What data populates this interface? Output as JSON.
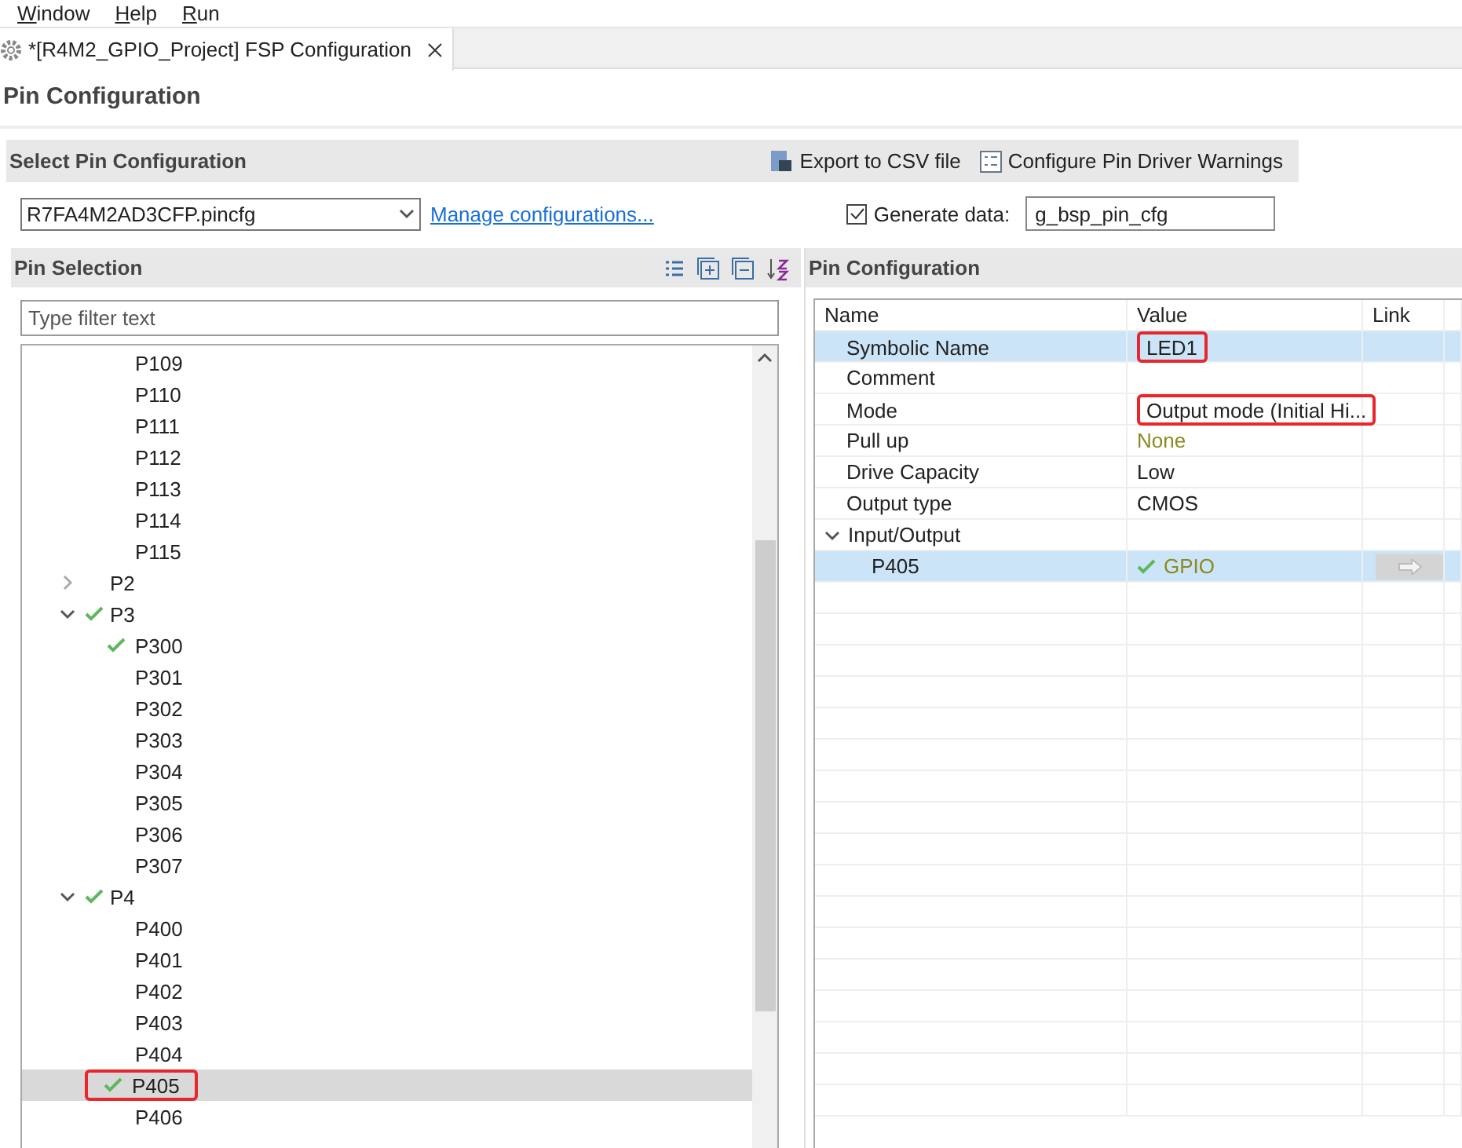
{
  "menu": [
    {
      "label": "Window"
    },
    {
      "label": "Help"
    },
    {
      "label": "Run"
    }
  ],
  "editor_tab": {
    "title": "*[R4M2_GPIO_Project] FSP Configuration",
    "selected": true
  },
  "page_title": "Pin Configuration",
  "select_section": {
    "title": "Select Pin Configuration",
    "actions": [
      {
        "kind": "export",
        "label": "Export to CSV file"
      },
      {
        "kind": "warnings",
        "label": "Configure Pin Driver Warnings"
      }
    ],
    "config_file": "R7FA4M2AD3CFP.pincfg",
    "manage_link": "Manage configurations...",
    "generate": {
      "label": "Generate data:",
      "checked": true,
      "value": "g_bsp_pin_cfg"
    }
  },
  "pin_selection": {
    "title": "Pin Selection",
    "filter_placeholder": "Type filter text",
    "tree": [
      {
        "children": [
          {
            "label": "P109",
            "checked": false,
            "selected": false
          },
          {
            "label": "P110",
            "checked": false,
            "selected": false
          },
          {
            "label": "P111",
            "checked": false,
            "selected": false
          },
          {
            "label": "P112",
            "checked": false,
            "selected": false
          },
          {
            "label": "P113",
            "checked": false,
            "selected": false
          },
          {
            "label": "P114",
            "checked": false,
            "selected": false
          },
          {
            "label": "P115",
            "checked": false,
            "selected": false
          }
        ]
      },
      {
        "label": "P2",
        "expanded": false,
        "checked": false
      },
      {
        "label": "P3",
        "expanded": true,
        "checked": true,
        "children": [
          {
            "label": "P300",
            "checked": true,
            "selected": false
          },
          {
            "label": "P301",
            "checked": false,
            "selected": false
          },
          {
            "label": "P302",
            "checked": false,
            "selected": false
          },
          {
            "label": "P303",
            "checked": false,
            "selected": false
          },
          {
            "label": "P304",
            "checked": false,
            "selected": false
          },
          {
            "label": "P305",
            "checked": false,
            "selected": false
          },
          {
            "label": "P306",
            "checked": false,
            "selected": false
          },
          {
            "label": "P307",
            "checked": false,
            "selected": false
          }
        ]
      },
      {
        "label": "P4",
        "expanded": true,
        "checked": true,
        "children": [
          {
            "label": "P400",
            "checked": false,
            "selected": false
          },
          {
            "label": "P401",
            "checked": false,
            "selected": false
          },
          {
            "label": "P402",
            "checked": false,
            "selected": false
          },
          {
            "label": "P403",
            "checked": false,
            "selected": false
          },
          {
            "label": "P404",
            "checked": false,
            "selected": false
          },
          {
            "label": "P405",
            "checked": true,
            "selected": true,
            "annotated": true
          },
          {
            "label": "P406",
            "checked": false,
            "selected": false
          }
        ]
      }
    ]
  },
  "pin_configuration": {
    "title": "Pin Configuration",
    "columns": [
      "Name",
      "Value",
      "Link"
    ],
    "rows": [
      {
        "name": "Symbolic Name",
        "value": "LED1",
        "selected": true,
        "annotated": true
      },
      {
        "name": "Comment",
        "selected": false
      },
      {
        "name": "Mode",
        "value": "Output mode (Initial Hi...",
        "selected": false,
        "annotated": true
      },
      {
        "name": "Pull up",
        "value": "None",
        "muted": true,
        "selected": false
      },
      {
        "name": "Drive Capacity",
        "value": "Low",
        "selected": false
      },
      {
        "name": "Output type",
        "value": "CMOS",
        "selected": false
      },
      {
        "name": "Input/Output",
        "expanded": true,
        "selected": false,
        "children": [
          {
            "name": "P405",
            "value": "GPIO",
            "muted": true,
            "checked": true,
            "link": true,
            "selected": true
          }
        ]
      }
    ]
  }
}
